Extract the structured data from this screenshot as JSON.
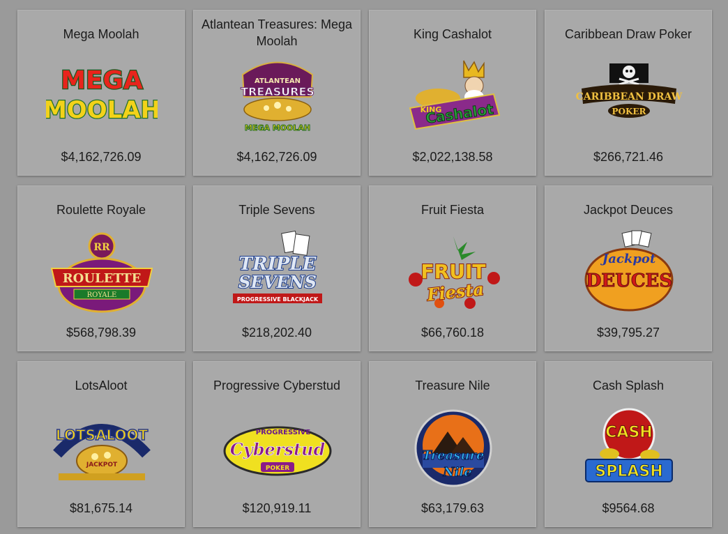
{
  "games": [
    {
      "title": "Mega Moolah",
      "amount": "$4,162,726.09",
      "logo_icon": "mega-moolah-logo-icon",
      "logo_text": [
        "MEGA",
        "MOOLAH"
      ]
    },
    {
      "title": "Atlantean Treasures: Mega Moolah",
      "amount": "$4,162,726.09",
      "logo_icon": "atlantean-treasures-logo-icon",
      "logo_text": [
        "ATLANTEAN",
        "TREASURES",
        "MEGA MOOLAH"
      ]
    },
    {
      "title": "King Cashalot",
      "amount": "$2,022,138.58",
      "logo_icon": "king-cashalot-logo-icon",
      "logo_text": [
        "KING",
        "Cashalot"
      ]
    },
    {
      "title": "Caribbean Draw Poker",
      "amount": "$266,721.46",
      "logo_icon": "caribbean-draw-poker-logo-icon",
      "logo_text": [
        "CARIBBEAN DRAW",
        "POKER"
      ]
    },
    {
      "title": "Roulette Royale",
      "amount": "$568,798.39",
      "logo_icon": "roulette-royale-logo-icon",
      "logo_text": [
        "RR",
        "ROULETTE",
        "ROYALE"
      ]
    },
    {
      "title": "Triple Sevens",
      "amount": "$218,202.40",
      "logo_icon": "triple-sevens-logo-icon",
      "logo_text": [
        "TRIPLE",
        "SEVENS",
        "PROGRESSIVE BLACKJACK"
      ]
    },
    {
      "title": "Fruit Fiesta",
      "amount": "$66,760.18",
      "logo_icon": "fruit-fiesta-logo-icon",
      "logo_text": [
        "FRUIT",
        "Fiesta"
      ]
    },
    {
      "title": "Jackpot Deuces",
      "amount": "$39,795.27",
      "logo_icon": "jackpot-deuces-logo-icon",
      "logo_text": [
        "Jackpot",
        "DEUCES"
      ]
    },
    {
      "title": "LotsAloot",
      "amount": "$81,675.14",
      "logo_icon": "lotsaloot-logo-icon",
      "logo_text": [
        "LOTSALOOT",
        "JACKPOT"
      ]
    },
    {
      "title": "Progressive Cyberstud",
      "amount": "$120,919.11",
      "logo_icon": "progressive-cyberstud-logo-icon",
      "logo_text": [
        "PROGRESSIVE",
        "Cyberstud",
        "POKER"
      ]
    },
    {
      "title": "Treasure Nile",
      "amount": "$63,179.63",
      "logo_icon": "treasure-nile-logo-icon",
      "logo_text": [
        "Treasure",
        "Nile"
      ]
    },
    {
      "title": "Cash Splash",
      "amount": "$9564.68",
      "logo_icon": "cash-splash-logo-icon",
      "logo_text": [
        "CASH",
        "SPLASH"
      ]
    }
  ]
}
